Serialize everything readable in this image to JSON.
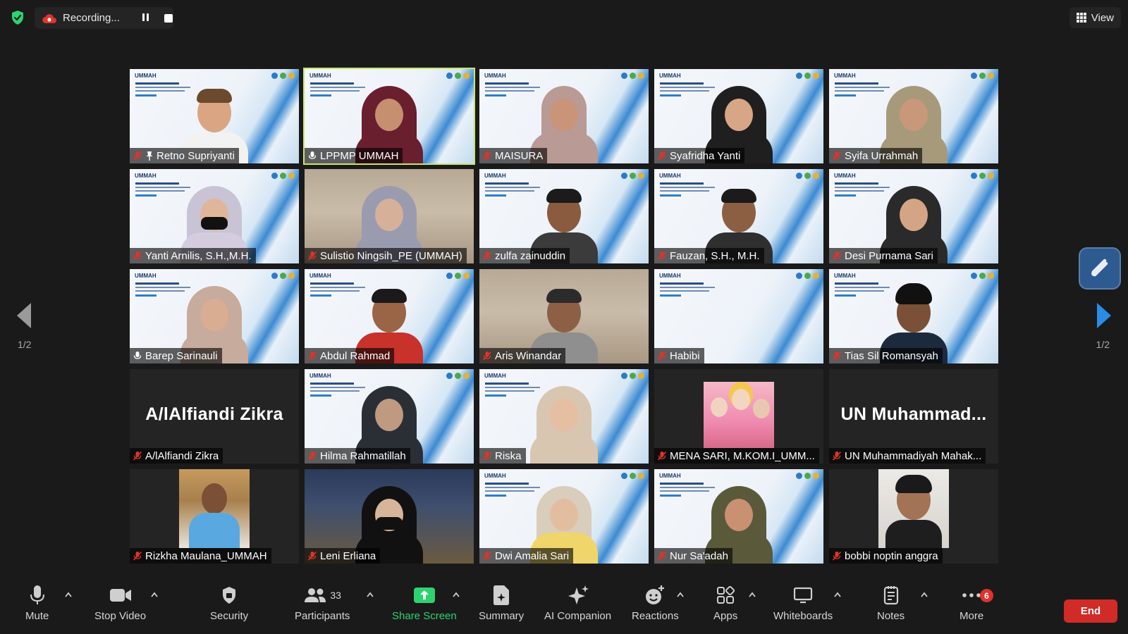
{
  "recording": {
    "status_text": "Recording..."
  },
  "view_button": {
    "label": "View"
  },
  "pagination": {
    "left_label": "1/2",
    "right_label": "1/2"
  },
  "slide": {
    "logo_text": "UMMAH"
  },
  "tiles": [
    {
      "name": "Retno Supriyanti",
      "muted": true,
      "pinned": true,
      "type": "video-slide"
    },
    {
      "name": "LPPMP UMMAH",
      "muted": false,
      "active_speaker": true,
      "type": "video-slide"
    },
    {
      "name": "MAISURA",
      "muted": true,
      "type": "video-slide"
    },
    {
      "name": "Syafridha Yanti",
      "muted": true,
      "type": "video-slide"
    },
    {
      "name": "Syifa Urrahmah",
      "muted": true,
      "type": "video-slide"
    },
    {
      "name": "Yanti Arnilis, S.H.,M.H.",
      "muted": true,
      "type": "video-slide"
    },
    {
      "name": "Sulistio Ningsih_PE (UMMAH)",
      "muted": true,
      "type": "video-room"
    },
    {
      "name": "zulfa zainuddin",
      "muted": true,
      "type": "video-slide"
    },
    {
      "name": "Fauzan, S.H., M.H.",
      "muted": true,
      "type": "video-slide"
    },
    {
      "name": "Desi Purnama Sari",
      "muted": true,
      "type": "video-slide"
    },
    {
      "name": "Barep Sarinauli",
      "muted": false,
      "type": "video-slide"
    },
    {
      "name": "Abdul Rahmad",
      "muted": true,
      "type": "video-slide"
    },
    {
      "name": "Aris Winandar",
      "muted": true,
      "type": "video-room"
    },
    {
      "name": "Habibi",
      "muted": true,
      "type": "video-slide-empty"
    },
    {
      "name": "Tias Sil Romansyah",
      "muted": true,
      "type": "video-slide"
    },
    {
      "name": "A/lAlfiandi Zikra",
      "display_name": "A/lAlfiandi Zikra",
      "muted": true,
      "type": "name-only"
    },
    {
      "name": "Hilma Rahmatillah",
      "muted": true,
      "type": "video-slide"
    },
    {
      "name": "Riska",
      "muted": true,
      "type": "video-slide"
    },
    {
      "name": "MENA SARI, M.KOM.I_UMM...",
      "muted": true,
      "type": "photo"
    },
    {
      "name": "UN Muhammadiyah Mahak...",
      "display_name": "UN  Muhammad...",
      "muted": true,
      "type": "name-only"
    },
    {
      "name": "Rizkha Maulana_UMMAH",
      "muted": true,
      "type": "photo"
    },
    {
      "name": "Leni Erliana",
      "muted": true,
      "type": "video-night"
    },
    {
      "name": "Dwi Amalia Sari",
      "muted": true,
      "type": "video-slide"
    },
    {
      "name": "Nur Sa'adah",
      "muted": true,
      "type": "video-slide"
    },
    {
      "name": "bobbi noptin anggra",
      "muted": true,
      "type": "photo"
    }
  ],
  "toolbar": {
    "mute": "Mute",
    "stop_video": "Stop Video",
    "security": "Security",
    "participants": "Participants",
    "participants_count": "33",
    "share_screen": "Share Screen",
    "summary": "Summary",
    "ai_companion": "AI Companion",
    "reactions": "Reactions",
    "apps": "Apps",
    "whiteboards": "Whiteboards",
    "notes": "Notes",
    "more": "More",
    "more_badge": "6",
    "end": "End"
  },
  "colors": {
    "background": "#1a1a1a",
    "active_speaker_border": "#c8e66a",
    "muted_icon": "#e0332b",
    "share_green": "#2dd36f",
    "end_red": "#d12b27",
    "shield_green": "#2dd36f"
  }
}
